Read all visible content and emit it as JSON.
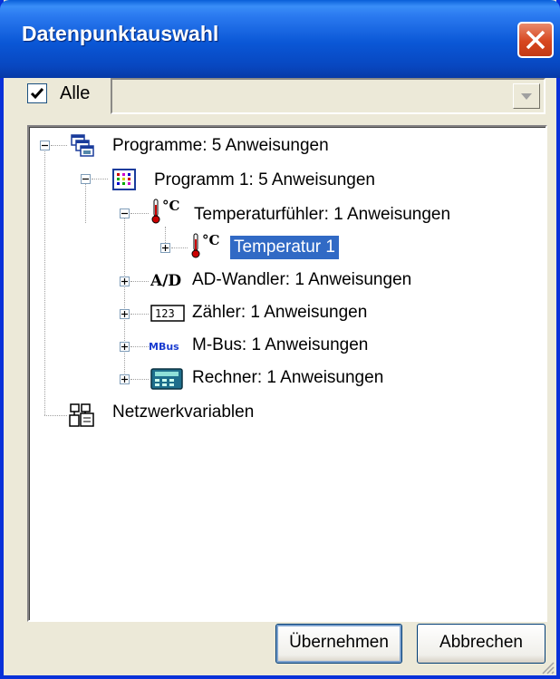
{
  "window": {
    "title": "Datenpunktauswahl"
  },
  "filter": {
    "checkbox_label": "Alle",
    "checked": true,
    "combo_value": ""
  },
  "tree": {
    "root": {
      "label": "Programme: 5 Anweisungen",
      "icon": "programs-icon"
    },
    "program": {
      "label": "Programm 1: 5 Anweisungen",
      "icon": "program-grid-icon"
    },
    "temp_sensor": {
      "label": "Temperaturfühler: 1 Anweisungen",
      "icon": "thermometer-icon",
      "icon_text": "°C"
    },
    "temp1": {
      "label": "Temperatur 1",
      "icon": "thermometer-icon",
      "icon_text": "°C",
      "selected": true
    },
    "ad": {
      "label": "AD-Wandler: 1 Anweisungen",
      "icon": "ad-converter-icon",
      "icon_text": "A/D"
    },
    "counter": {
      "label": "Zähler: 1 Anweisungen",
      "icon": "counter-icon",
      "icon_text": "123"
    },
    "mbus": {
      "label": "M-Bus: 1 Anweisungen",
      "icon": "mbus-icon",
      "icon_text": "MBus"
    },
    "calc": {
      "label": "Rechner: 1 Anweisungen",
      "icon": "calculator-icon"
    },
    "network": {
      "label": "Netzwerkvariablen",
      "icon": "network-variables-icon"
    }
  },
  "buttons": {
    "apply": "Übernehmen",
    "cancel": "Abbrechen"
  },
  "colors": {
    "titlebar": "#0a57d6",
    "selection": "#316ac5",
    "close": "#d7461f"
  }
}
